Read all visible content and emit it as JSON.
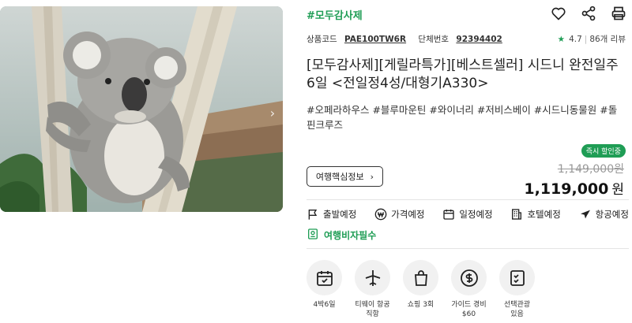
{
  "product": {
    "tag": "#모두감사제",
    "meta": {
      "code_label": "상품코드",
      "code_value": "PAE100TW6R",
      "group_label": "단체번호",
      "group_value": "92394402"
    },
    "rating": {
      "score": "4.7",
      "reviews": "86개 리뷰"
    },
    "title": "[모두감사제][게릴라특가][베스트셀러] 시드니 완전일주 6일 <전일정4성/대형기A330>",
    "hashtags": "#오페라하우스 #블루마운틴 #와이너리 #저비스베이 #시드니동물원 #돌핀크루즈",
    "badge": "즉시 할인중",
    "original_price": "1,149,000원",
    "sale_price": "1,119,000",
    "sale_unit": "원",
    "info_button": "여행핵심정보",
    "info_button_arrow": "›"
  },
  "tabs": [
    {
      "label": "출발예정",
      "icon": "flag-icon"
    },
    {
      "label": "가격예정",
      "icon": "won-icon"
    },
    {
      "label": "일정예정",
      "icon": "calendar-icon"
    },
    {
      "label": "호텔예정",
      "icon": "hotel-icon"
    },
    {
      "label": "항공예정",
      "icon": "plane-icon"
    }
  ],
  "visa": {
    "label": "여행비자필수",
    "icon": "visa-icon"
  },
  "features": [
    {
      "label": "4박6일",
      "icon": "calendar-check-icon"
    },
    {
      "label": "티웨이 항공\n직항",
      "icon": "airplane-icon"
    },
    {
      "label": "쇼핑 3회",
      "icon": "shopping-bag-icon"
    },
    {
      "label": "가이드 경비\n$60",
      "icon": "dollar-icon"
    },
    {
      "label": "선택관광\n있음",
      "icon": "checklist-icon"
    }
  ],
  "colors": {
    "accent": "#1f9d55",
    "text": "#222222",
    "muted": "#999999"
  },
  "image": {
    "subject": "koala-photo"
  }
}
